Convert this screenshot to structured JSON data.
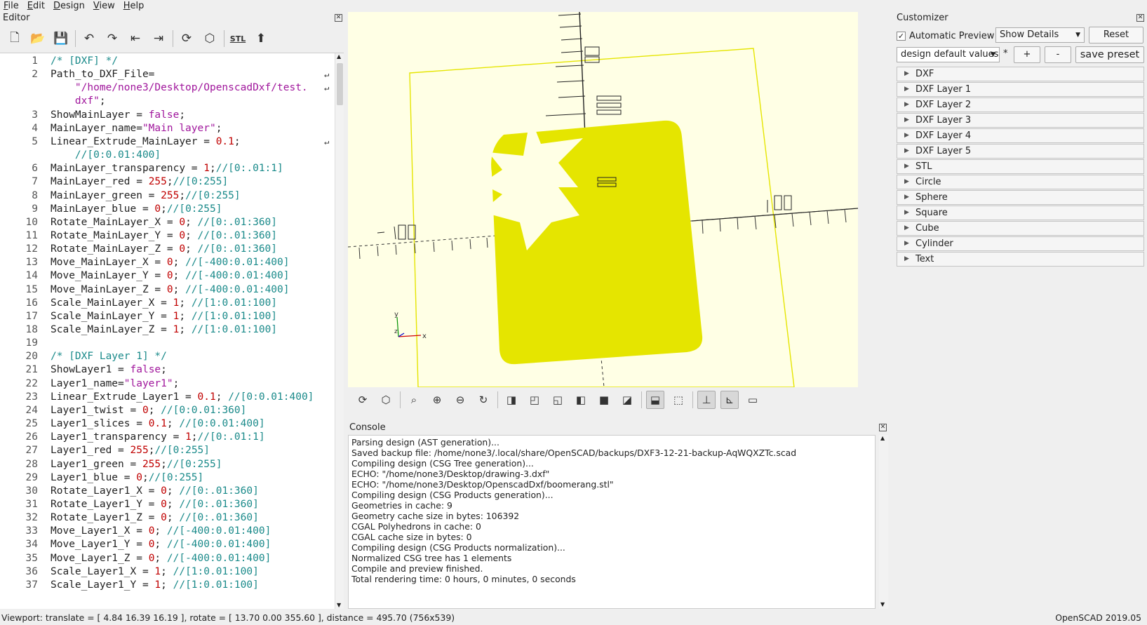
{
  "menu": [
    {
      "label": "File",
      "hotkey": "F",
      "rest": "ile"
    },
    {
      "label": "Edit",
      "hotkey": "E",
      "rest": "dit"
    },
    {
      "label": "Design",
      "hotkey": "D",
      "rest": "esign"
    },
    {
      "label": "View",
      "hotkey": "V",
      "rest": "iew"
    },
    {
      "label": "Help",
      "hotkey": "H",
      "rest": "elp"
    }
  ],
  "editor": {
    "title": "Editor",
    "toolbar_icons": [
      "new-file-icon",
      "open-file-icon",
      "save-icon",
      "undo-icon",
      "redo-icon",
      "unindent-icon",
      "indent-icon",
      "preview-icon",
      "render-icon",
      "export-stl-icon",
      "send-to-3d-print-icon"
    ],
    "lines": [
      {
        "n": "1",
        "parts": [
          [
            "c-com",
            "/* [DXF] */"
          ]
        ]
      },
      {
        "n": "2",
        "parts": [
          [
            "c-id",
            "Path_to_DXF_File="
          ]
        ],
        "wrap": true
      },
      {
        "n": "",
        "parts": [
          [
            "c-str",
            "    \"/home/none3/Desktop/OpenscadDxf/test."
          ]
        ],
        "wrap": true
      },
      {
        "n": "",
        "parts": [
          [
            "c-str",
            "    dxf\""
          ],
          [
            "c-id",
            ";"
          ]
        ]
      },
      {
        "n": "3",
        "parts": [
          [
            "c-id",
            "ShowMainLayer = "
          ],
          [
            "c-str",
            "false"
          ],
          [
            "c-id",
            ";"
          ]
        ]
      },
      {
        "n": "4",
        "parts": [
          [
            "c-id",
            "MainLayer_name="
          ],
          [
            "c-str",
            "\"Main layer\""
          ],
          [
            "c-id",
            ";"
          ]
        ]
      },
      {
        "n": "5",
        "parts": [
          [
            "c-id",
            "Linear_Extrude_MainLayer = "
          ],
          [
            "c-num",
            "0.1"
          ],
          [
            "c-id",
            ";"
          ]
        ],
        "wrap": true
      },
      {
        "n": "",
        "parts": [
          [
            "c-com",
            "    //[0:0.01:400]"
          ]
        ]
      },
      {
        "n": "6",
        "parts": [
          [
            "c-id",
            "MainLayer_transparency = "
          ],
          [
            "c-num",
            "1"
          ],
          [
            "c-id",
            ";"
          ],
          [
            "c-com",
            "//[0:.01:1]"
          ]
        ]
      },
      {
        "n": "7",
        "parts": [
          [
            "c-id",
            "MainLayer_red = "
          ],
          [
            "c-num",
            "255"
          ],
          [
            "c-id",
            ";"
          ],
          [
            "c-com",
            "//[0:255]"
          ]
        ]
      },
      {
        "n": "8",
        "parts": [
          [
            "c-id",
            "MainLayer_green = "
          ],
          [
            "c-num",
            "255"
          ],
          [
            "c-id",
            ";"
          ],
          [
            "c-com",
            "//[0:255]"
          ]
        ]
      },
      {
        "n": "9",
        "parts": [
          [
            "c-id",
            "MainLayer_blue = "
          ],
          [
            "c-num",
            "0"
          ],
          [
            "c-id",
            ";"
          ],
          [
            "c-com",
            "//[0:255]"
          ]
        ]
      },
      {
        "n": "10",
        "parts": [
          [
            "c-id",
            "Rotate_MainLayer_X = "
          ],
          [
            "c-num",
            "0"
          ],
          [
            "c-id",
            "; "
          ],
          [
            "c-com",
            "//[0:.01:360]"
          ]
        ]
      },
      {
        "n": "11",
        "parts": [
          [
            "c-id",
            "Rotate_MainLayer_Y = "
          ],
          [
            "c-num",
            "0"
          ],
          [
            "c-id",
            "; "
          ],
          [
            "c-com",
            "//[0:.01:360]"
          ]
        ]
      },
      {
        "n": "12",
        "parts": [
          [
            "c-id",
            "Rotate_MainLayer_Z = "
          ],
          [
            "c-num",
            "0"
          ],
          [
            "c-id",
            "; "
          ],
          [
            "c-com",
            "//[0:.01:360]"
          ]
        ]
      },
      {
        "n": "13",
        "parts": [
          [
            "c-id",
            "Move_MainLayer_X = "
          ],
          [
            "c-num",
            "0"
          ],
          [
            "c-id",
            "; "
          ],
          [
            "c-com",
            "//[-400:0.01:400]"
          ]
        ]
      },
      {
        "n": "14",
        "parts": [
          [
            "c-id",
            "Move_MainLayer_Y = "
          ],
          [
            "c-num",
            "0"
          ],
          [
            "c-id",
            "; "
          ],
          [
            "c-com",
            "//[-400:0.01:400]"
          ]
        ]
      },
      {
        "n": "15",
        "parts": [
          [
            "c-id",
            "Move_MainLayer_Z = "
          ],
          [
            "c-num",
            "0"
          ],
          [
            "c-id",
            "; "
          ],
          [
            "c-com",
            "//[-400:0.01:400]"
          ]
        ]
      },
      {
        "n": "16",
        "parts": [
          [
            "c-id",
            "Scale_MainLayer_X = "
          ],
          [
            "c-num",
            "1"
          ],
          [
            "c-id",
            "; "
          ],
          [
            "c-com",
            "//[1:0.01:100]"
          ]
        ]
      },
      {
        "n": "17",
        "parts": [
          [
            "c-id",
            "Scale_MainLayer_Y = "
          ],
          [
            "c-num",
            "1"
          ],
          [
            "c-id",
            "; "
          ],
          [
            "c-com",
            "//[1:0.01:100]"
          ]
        ]
      },
      {
        "n": "18",
        "parts": [
          [
            "c-id",
            "Scale_MainLayer_Z = "
          ],
          [
            "c-num",
            "1"
          ],
          [
            "c-id",
            "; "
          ],
          [
            "c-com",
            "//[1:0.01:100]"
          ]
        ]
      },
      {
        "n": "19",
        "parts": []
      },
      {
        "n": "20",
        "parts": [
          [
            "c-com",
            "/* [DXF Layer 1] */"
          ]
        ]
      },
      {
        "n": "21",
        "parts": [
          [
            "c-id",
            "ShowLayer1 = "
          ],
          [
            "c-str",
            "false"
          ],
          [
            "c-id",
            ";"
          ]
        ]
      },
      {
        "n": "22",
        "parts": [
          [
            "c-id",
            "Layer1_name="
          ],
          [
            "c-str",
            "\"layer1\""
          ],
          [
            "c-id",
            ";"
          ]
        ]
      },
      {
        "n": "23",
        "parts": [
          [
            "c-id",
            "Linear_Extrude_Layer1 = "
          ],
          [
            "c-num",
            "0.1"
          ],
          [
            "c-id",
            "; "
          ],
          [
            "c-com",
            "//[0:0.01:400]"
          ]
        ]
      },
      {
        "n": "24",
        "parts": [
          [
            "c-id",
            "Layer1_twist = "
          ],
          [
            "c-num",
            "0"
          ],
          [
            "c-id",
            "; "
          ],
          [
            "c-com",
            "//[0:0.01:360]"
          ]
        ]
      },
      {
        "n": "25",
        "parts": [
          [
            "c-id",
            "Layer1_slices = "
          ],
          [
            "c-num",
            "0.1"
          ],
          [
            "c-id",
            "; "
          ],
          [
            "c-com",
            "//[0:0.01:400]"
          ]
        ]
      },
      {
        "n": "26",
        "parts": [
          [
            "c-id",
            "Layer1_transparency = "
          ],
          [
            "c-num",
            "1"
          ],
          [
            "c-id",
            ";"
          ],
          [
            "c-com",
            "//[0:.01:1]"
          ]
        ]
      },
      {
        "n": "27",
        "parts": [
          [
            "c-id",
            "Layer1_red = "
          ],
          [
            "c-num",
            "255"
          ],
          [
            "c-id",
            ";"
          ],
          [
            "c-com",
            "//[0:255]"
          ]
        ]
      },
      {
        "n": "28",
        "parts": [
          [
            "c-id",
            "Layer1_green = "
          ],
          [
            "c-num",
            "255"
          ],
          [
            "c-id",
            ";"
          ],
          [
            "c-com",
            "//[0:255]"
          ]
        ]
      },
      {
        "n": "29",
        "parts": [
          [
            "c-id",
            "Layer1_blue = "
          ],
          [
            "c-num",
            "0"
          ],
          [
            "c-id",
            ";"
          ],
          [
            "c-com",
            "//[0:255]"
          ]
        ]
      },
      {
        "n": "30",
        "parts": [
          [
            "c-id",
            "Rotate_Layer1_X = "
          ],
          [
            "c-num",
            "0"
          ],
          [
            "c-id",
            "; "
          ],
          [
            "c-com",
            "//[0:.01:360]"
          ]
        ]
      },
      {
        "n": "31",
        "parts": [
          [
            "c-id",
            "Rotate_Layer1_Y = "
          ],
          [
            "c-num",
            "0"
          ],
          [
            "c-id",
            "; "
          ],
          [
            "c-com",
            "//[0:.01:360]"
          ]
        ]
      },
      {
        "n": "32",
        "parts": [
          [
            "c-id",
            "Rotate_Layer1_Z = "
          ],
          [
            "c-num",
            "0"
          ],
          [
            "c-id",
            "; "
          ],
          [
            "c-com",
            "//[0:.01:360]"
          ]
        ]
      },
      {
        "n": "33",
        "parts": [
          [
            "c-id",
            "Move_Layer1_X = "
          ],
          [
            "c-num",
            "0"
          ],
          [
            "c-id",
            "; "
          ],
          [
            "c-com",
            "//[-400:0.01:400]"
          ]
        ]
      },
      {
        "n": "34",
        "parts": [
          [
            "c-id",
            "Move_Layer1_Y = "
          ],
          [
            "c-num",
            "0"
          ],
          [
            "c-id",
            "; "
          ],
          [
            "c-com",
            "//[-400:0.01:400]"
          ]
        ]
      },
      {
        "n": "35",
        "parts": [
          [
            "c-id",
            "Move_Layer1_Z = "
          ],
          [
            "c-num",
            "0"
          ],
          [
            "c-id",
            "; "
          ],
          [
            "c-com",
            "//[-400:0.01:400]"
          ]
        ]
      },
      {
        "n": "36",
        "parts": [
          [
            "c-id",
            "Scale_Layer1_X = "
          ],
          [
            "c-num",
            "1"
          ],
          [
            "c-id",
            "; "
          ],
          [
            "c-com",
            "//[1:0.01:100]"
          ]
        ]
      },
      {
        "n": "37",
        "parts": [
          [
            "c-id",
            "Scale_Layer1_Y = "
          ],
          [
            "c-num",
            "1"
          ],
          [
            "c-id",
            "; "
          ],
          [
            "c-com",
            "//[1:0.01:100]"
          ]
        ]
      }
    ]
  },
  "viewport": {
    "background": "#ffffe5",
    "model_color": "#e5e500",
    "axis_labels": {
      "x": "x",
      "y": "y",
      "z": "z"
    }
  },
  "view_toolbar_icons": [
    {
      "name": "preview-icon",
      "glyph": "⟳",
      "active": false
    },
    {
      "name": "render-icon",
      "glyph": "⬡",
      "active": false
    },
    {
      "name": "view-all-icon",
      "glyph": "⌕",
      "active": false
    },
    {
      "name": "zoom-in-icon",
      "glyph": "⊕",
      "active": false
    },
    {
      "name": "zoom-out-icon",
      "glyph": "⊖",
      "active": false
    },
    {
      "name": "reset-view-icon",
      "glyph": "↻",
      "active": false
    },
    {
      "name": "view-right-icon",
      "glyph": "◨",
      "active": false
    },
    {
      "name": "view-top-icon",
      "glyph": "◰",
      "active": false
    },
    {
      "name": "view-bottom-icon",
      "glyph": "◱",
      "active": false
    },
    {
      "name": "view-left-icon",
      "glyph": "◧",
      "active": false
    },
    {
      "name": "view-front-icon",
      "glyph": "■",
      "active": false
    },
    {
      "name": "view-back-icon",
      "glyph": "◪",
      "active": false
    },
    {
      "name": "perspective-icon",
      "glyph": "⬓",
      "active": true
    },
    {
      "name": "orthogonal-icon",
      "glyph": "⬚",
      "active": false
    },
    {
      "name": "show-axes-icon",
      "glyph": "⊥",
      "active": true
    },
    {
      "name": "show-scale-markers-icon",
      "glyph": "⊾",
      "active": true
    },
    {
      "name": "show-edges-icon",
      "glyph": "▭",
      "active": false
    }
  ],
  "console": {
    "title": "Console",
    "lines": [
      "Parsing design (AST generation)...",
      "Saved backup file: /home/none3/.local/share/OpenSCAD/backups/DXF3-12-21-backup-AqWQXZTc.scad",
      "Compiling design (CSG Tree generation)...",
      "ECHO: \"/home/none3/Desktop/drawing-3.dxf\"",
      "ECHO: \"/home/none3/Desktop/OpenscadDxf/boomerang.stl\"",
      "Compiling design (CSG Products generation)...",
      "Geometries in cache: 9",
      "Geometry cache size in bytes: 106392",
      "CGAL Polyhedrons in cache: 0",
      "CGAL cache size in bytes: 0",
      "Compiling design (CSG Products normalization)...",
      "Normalized CSG tree has 1 elements",
      "Compile and preview finished.",
      "Total rendering time: 0 hours, 0 minutes, 0 seconds"
    ]
  },
  "customizer": {
    "title": "Customizer",
    "automatic_preview_label": "Automatic Preview",
    "automatic_preview_checked": "✓",
    "details_select": "Show Details",
    "reset_label": "Reset",
    "preset_select": "design default values",
    "preset_modified": "*",
    "add_label": "+",
    "remove_label": "-",
    "save_preset_label": "save preset",
    "sections": [
      "DXF",
      "DXF Layer 1",
      "DXF Layer 2",
      "DXF Layer 3",
      "DXF Layer 4",
      "DXF Layer 5",
      "STL",
      "Circle",
      "Sphere",
      "Square",
      "Cube",
      "Cylinder",
      "Text"
    ]
  },
  "status": {
    "viewport": "Viewport: translate = [ 4.84 16.39 16.19 ], rotate = [ 13.70 0.00 355.60 ], distance = 495.70 (756x539)",
    "version": "OpenSCAD 2019.05"
  }
}
